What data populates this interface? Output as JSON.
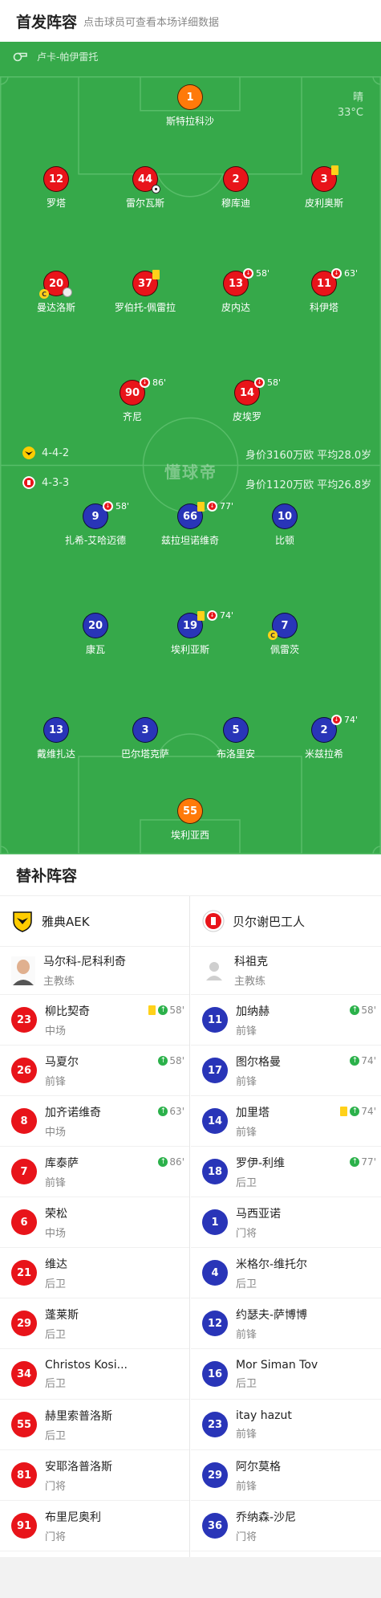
{
  "header": {
    "title": "首发阵容",
    "subtitle": "点击球员可查看本场详细数据"
  },
  "pitch": {
    "referee": "卢卡-帕伊雷托",
    "weather": {
      "condition": "晴",
      "temp": "33°C"
    },
    "watermark": "懂球帝",
    "home": {
      "formation": "4-4-2",
      "value": "身价3160万欧 平均28.0岁"
    },
    "away": {
      "formation": "4-3-3",
      "value": "身价1120万欧 平均26.8岁"
    }
  },
  "home_players": [
    {
      "num": "1",
      "name": "斯特拉科沙",
      "gk": true
    },
    {
      "num": "12",
      "name": "罗塔"
    },
    {
      "num": "44",
      "name": "雷尔瓦斯",
      "goal": true
    },
    {
      "num": "2",
      "name": "穆库迪"
    },
    {
      "num": "3",
      "name": "皮利奥斯",
      "yellow": true
    },
    {
      "num": "20",
      "name": "曼达洛斯",
      "captain": "C",
      "assist": true
    },
    {
      "num": "37",
      "name": "罗伯托-佩雷拉",
      "yellow": true
    },
    {
      "num": "13",
      "name": "皮内达",
      "sub_off": "58'"
    },
    {
      "num": "11",
      "name": "科伊塔",
      "sub_off": "63'"
    },
    {
      "num": "90",
      "name": "齐尼",
      "sub_off": "86'"
    },
    {
      "num": "14",
      "name": "皮埃罗",
      "sub_off": "58'"
    }
  ],
  "away_players": [
    {
      "num": "9",
      "name": "扎希-艾哈迈德",
      "sub_off": "58'"
    },
    {
      "num": "66",
      "name": "兹拉坦诺维奇",
      "yellow": true,
      "sub_off": "77'"
    },
    {
      "num": "10",
      "name": "比顿"
    },
    {
      "num": "20",
      "name": "康瓦"
    },
    {
      "num": "19",
      "name": "埃利亚斯",
      "yellow": true,
      "sub_off": "74'"
    },
    {
      "num": "7",
      "name": "佩雷茨",
      "captain": "C"
    },
    {
      "num": "13",
      "name": "戴维扎达"
    },
    {
      "num": "3",
      "name": "巴尔塔克萨"
    },
    {
      "num": "5",
      "name": "布洛里安"
    },
    {
      "num": "2",
      "name": "米兹拉希",
      "sub_off": "74'"
    },
    {
      "num": "55",
      "name": "埃利亚西",
      "gk": true
    }
  ],
  "subs": {
    "title": "替补阵容",
    "home": {
      "team": "雅典AEK",
      "coach": {
        "name": "马尔科-尼科利奇",
        "role": "主教练"
      },
      "players": [
        {
          "num": "23",
          "name": "柳比契奇",
          "pos": "中场",
          "yellow": true,
          "sub_on": "58'"
        },
        {
          "num": "26",
          "name": "马夏尔",
          "pos": "前锋",
          "sub_on": "58'"
        },
        {
          "num": "8",
          "name": "加齐诺维奇",
          "pos": "中场",
          "sub_on": "63'"
        },
        {
          "num": "7",
          "name": "库泰萨",
          "pos": "前锋",
          "sub_on": "86'"
        },
        {
          "num": "6",
          "name": "荣松",
          "pos": "中场"
        },
        {
          "num": "21",
          "name": "维达",
          "pos": "后卫"
        },
        {
          "num": "29",
          "name": "蓬莱斯",
          "pos": "后卫"
        },
        {
          "num": "34",
          "name": "Christos Kosi...",
          "pos": "后卫"
        },
        {
          "num": "55",
          "name": "赫里索普洛斯",
          "pos": "后卫"
        },
        {
          "num": "81",
          "name": "安耶洛普洛斯",
          "pos": "门将"
        },
        {
          "num": "91",
          "name": "布里尼奥利",
          "pos": "门将"
        }
      ]
    },
    "away": {
      "team": "贝尔谢巴工人",
      "coach": {
        "name": "科祖克",
        "role": "主教练"
      },
      "players": [
        {
          "num": "11",
          "name": "加纳赫",
          "pos": "前锋",
          "sub_on": "58'"
        },
        {
          "num": "17",
          "name": "图尔格曼",
          "pos": "前锋",
          "sub_on": "74'"
        },
        {
          "num": "14",
          "name": "加里塔",
          "pos": "前锋",
          "yellow": true,
          "sub_on": "74'"
        },
        {
          "num": "18",
          "name": "罗伊-利维",
          "pos": "后卫",
          "sub_on": "77'"
        },
        {
          "num": "1",
          "name": "马西亚诺",
          "pos": "门将"
        },
        {
          "num": "4",
          "name": "米格尔-维托尔",
          "pos": "后卫"
        },
        {
          "num": "12",
          "name": "约瑟夫-萨博博",
          "pos": "前锋"
        },
        {
          "num": "16",
          "name": "Mor Siman Tov",
          "pos": "后卫"
        },
        {
          "num": "23",
          "name": "itay hazut",
          "pos": "前锋"
        },
        {
          "num": "29",
          "name": "阿尔莫格",
          "pos": "前锋"
        },
        {
          "num": "36",
          "name": "乔纳森-沙尼",
          "pos": "门将"
        }
      ]
    }
  }
}
